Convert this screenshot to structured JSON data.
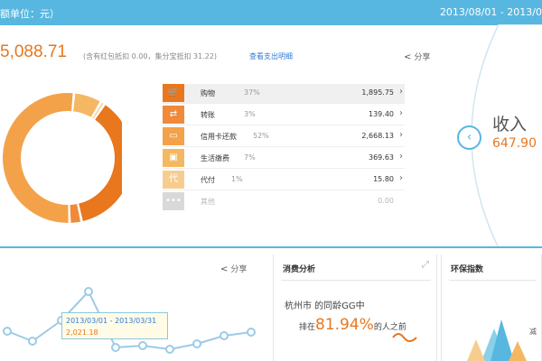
{
  "header": {
    "unit_text": "额单位：元）",
    "date_range": "2013/08/01 - 2013/0"
  },
  "summary": {
    "total": "5,088.71",
    "subnote": "(含有红包抵扣 0.00，集分宝抵扣 31.22)",
    "detail_link": "查看支出明细",
    "share": "分享"
  },
  "categories": [
    {
      "name": "购物",
      "percent": "37%",
      "amount": "1,895.75",
      "color": "#e8771e",
      "icon": "cart-icon",
      "glyph": "🛒"
    },
    {
      "name": "转账",
      "percent": "3%",
      "amount": "139.40",
      "color": "#f08a3a",
      "icon": "transfer-icon",
      "glyph": "⇄"
    },
    {
      "name": "信用卡还款",
      "percent": "52%",
      "amount": "2,668.13",
      "color": "#f3a24a",
      "icon": "credit-card-icon",
      "glyph": "▭"
    },
    {
      "name": "生活缴费",
      "percent": "7%",
      "amount": "369.63",
      "color": "#f4b863",
      "icon": "bill-icon",
      "glyph": "▣"
    },
    {
      "name": "代付",
      "percent": "1%",
      "amount": "15.80",
      "color": "#f7cd8f",
      "icon": "pay-for-others-icon",
      "glyph": "代"
    },
    {
      "name": "其他",
      "percent": "",
      "amount": "0.00",
      "color": "#d9d9d9",
      "icon": "other-icon",
      "glyph": "•••"
    }
  ],
  "income": {
    "label": "收入",
    "value": "647.90"
  },
  "bottom": {
    "share": "分享",
    "tooltip_range": "2013/03/01 - 2013/03/31",
    "tooltip_value": "2,021.18"
  },
  "consumption": {
    "title": "消费分析",
    "city_line": "杭州市 的同龄GG中",
    "rank_prefix": "排在",
    "rank_value": "81.94%",
    "rank_suffix": "的人之前"
  },
  "environment": {
    "title": "环保指数",
    "side_text": "减"
  },
  "colors": {
    "accent_blue": "#57b7e0",
    "accent_orange": "#e8771e"
  }
}
